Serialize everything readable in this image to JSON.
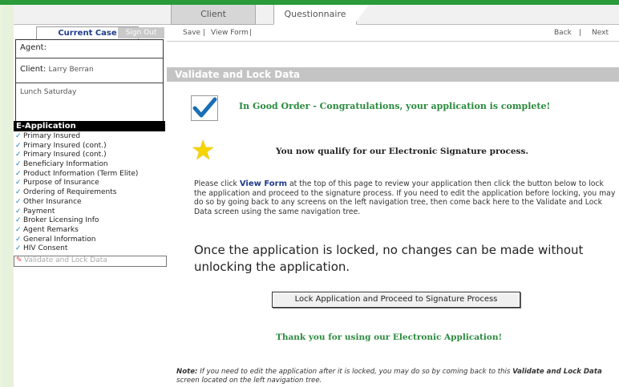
{
  "tabs": {
    "client": "Client",
    "questionnaire": "Questionnaire"
  },
  "sidebar": {
    "current_case_label": "Current Case",
    "signout_label": "Sign Out",
    "agent_label": "Agent:",
    "client_label": "Client:",
    "client_value": "Larry Berran",
    "note_value": "Lunch Saturday",
    "eapp_header": "E-Application",
    "items": [
      {
        "label": "Primary Insured"
      },
      {
        "label": "Primary Insured (cont.)"
      },
      {
        "label": "Primary Insured (cont.)"
      },
      {
        "label": "Beneficiary Information"
      },
      {
        "label": "Product Information (Term Elite)"
      },
      {
        "label": "Purpose of Insurance"
      },
      {
        "label": "Ordering of Requirements"
      },
      {
        "label": "Other Insurance"
      },
      {
        "label": "Payment"
      },
      {
        "label": "Broker Licensing Info"
      },
      {
        "label": "Agent Remarks"
      },
      {
        "label": "General Information"
      },
      {
        "label": "HIV Consent"
      },
      {
        "label": "Validate and Lock Data"
      }
    ]
  },
  "toolbar": {
    "save": "Save",
    "view_form": "View Form",
    "back": "Back",
    "next": "Next"
  },
  "main": {
    "section_title": "Validate and Lock Data",
    "good_order": "In Good Order - Congratulations, your application is complete!",
    "qualify": "You now qualify for our Electronic Signature process.",
    "para_before": "Please click ",
    "para_link": "View Form",
    "para_after": " at the top of this page to review your application then click the button below to lock the application and proceed to the signature process. If you need to edit the application before locking, you may do so by going back to any screens on the left navigation tree, then come back here to the Validate and Lock Data screen using the same navigation tree.",
    "big_notice": "Once the application is locked, no changes can be made without unlocking the application.",
    "lock_button": "Lock Application and Proceed to Signature Process",
    "thanks": "Thank you for using our Electronic Application!",
    "note_label": "Note:",
    "note_text_1": " If you need to edit the application after it is locked, you may do so by coming back to this ",
    "note_bold": "Validate and Lock Data",
    "note_text_2": " screen located on the left navigation tree."
  }
}
